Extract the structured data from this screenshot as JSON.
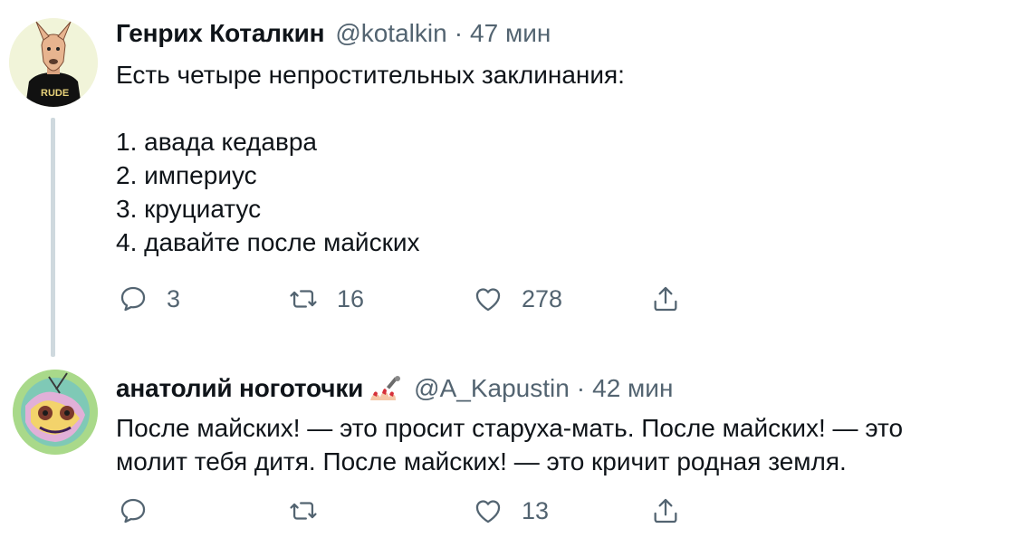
{
  "tweets": [
    {
      "author_name": "Генрих Коталкин",
      "handle": "@kotalkin",
      "separator": "·",
      "time": "47 мин",
      "text": "Есть четыре непростительных заклинания:\n\n1. авада кедавра\n2. империус\n3. круциатус\n4. давайте после майских",
      "avatar_icon": "doberman-avatar",
      "reply_count": "3",
      "retweet_count": "16",
      "like_count": "278",
      "share_count": ""
    },
    {
      "author_name": "анатолий ноготочки",
      "name_emoji": "nail-polish-emoji",
      "handle": "@A_Kapustin",
      "separator": "·",
      "time": "42 мин",
      "text": "После майских! — это просит старуха-мать. После майских! — это\nмолит тебя дитя. После майских! — это кричит родная земля.",
      "avatar_icon": "psychedelic-face-avatar",
      "reply_count": "",
      "retweet_count": "",
      "like_count": "13",
      "share_count": ""
    }
  ],
  "icons": {
    "reply": "speech-bubble-icon",
    "retweet": "retweet-icon",
    "like": "heart-icon",
    "share": "share-icon"
  },
  "colors": {
    "text_primary": "#0f1419",
    "text_secondary": "#536471",
    "thread_line": "#cfd9de"
  }
}
